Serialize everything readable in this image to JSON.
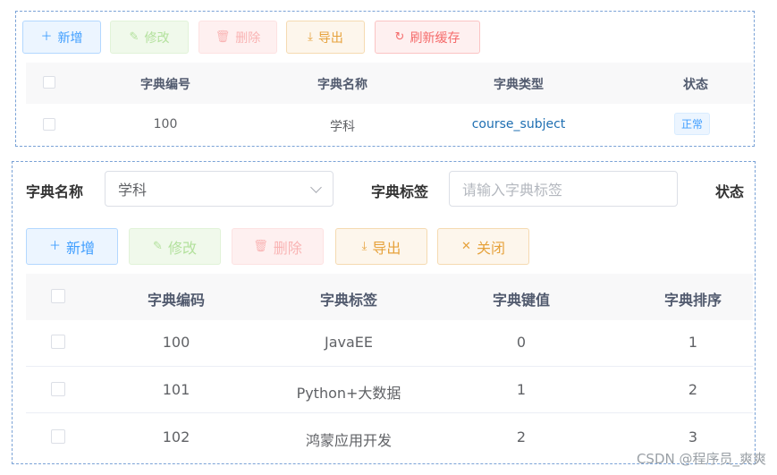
{
  "top_panel": {
    "toolbar": {
      "add": "新增",
      "edit": "修改",
      "delete": "删除",
      "export": "导出",
      "refresh_cache": "刷新缓存"
    },
    "table": {
      "columns": [
        "字典编号",
        "字典名称",
        "字典类型",
        "状态"
      ],
      "rows": [
        {
          "id": "100",
          "name": "学科",
          "type": "course_subject",
          "status": "正常"
        }
      ]
    }
  },
  "bottom_panel": {
    "filters": {
      "dict_name_label": "字典名称",
      "dict_name_value": "学科",
      "dict_label_label": "字典标签",
      "dict_label_placeholder": "请输入字典标签",
      "status_label": "状态"
    },
    "toolbar": {
      "add": "新增",
      "edit": "修改",
      "delete": "删除",
      "export": "导出",
      "close": "关闭"
    },
    "table": {
      "columns": [
        "字典编码",
        "字典标签",
        "字典键值",
        "字典排序"
      ],
      "rows": [
        {
          "code": "100",
          "label": "JavaEE",
          "value": "0",
          "sort": "1"
        },
        {
          "code": "101",
          "label": "Python+大数据",
          "value": "1",
          "sort": "2"
        },
        {
          "code": "102",
          "label": "鸿蒙应用开发",
          "value": "2",
          "sort": "3"
        }
      ]
    }
  },
  "watermark": "CSDN @程序员_爽爽",
  "colors": {
    "primary": "#409eff",
    "success": "#67c23a",
    "warning": "#e6a23c",
    "danger": "#f56c6c",
    "link": "#1f6fb2"
  }
}
